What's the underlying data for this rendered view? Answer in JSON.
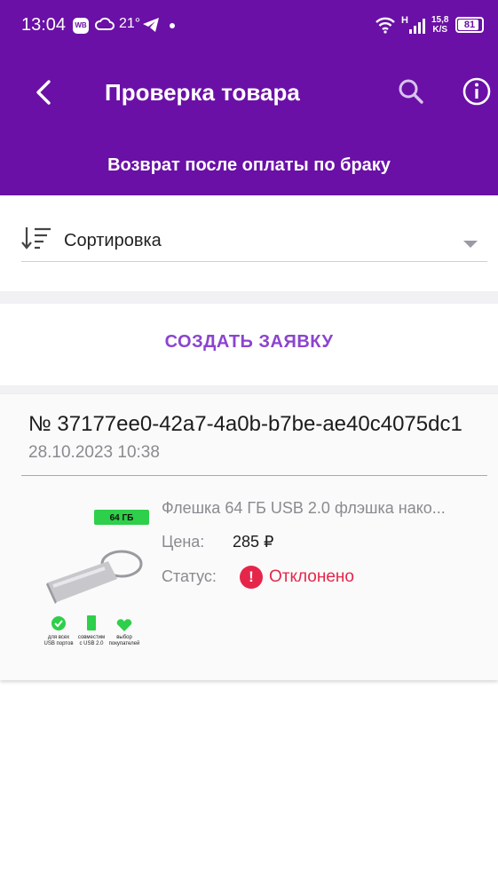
{
  "status_bar": {
    "time": "13:04",
    "wb_badge": "WB",
    "temperature": "21°",
    "network": "H",
    "speed_value": "15,8",
    "speed_unit": "K/S",
    "battery": "81",
    "battery_level": 0.81
  },
  "app_bar": {
    "title": "Проверка товара",
    "subtitle": "Возврат после оплаты по браку"
  },
  "sort": {
    "label": "Сортировка"
  },
  "actions": {
    "create_request": "СОЗДАТЬ ЗАЯВКУ"
  },
  "order": {
    "number": "№ 37177ee0-42a7-4a0b-b7be-ae40c4075dc1",
    "date": "28.10.2023 10:38",
    "product": {
      "name": "Флешка 64 ГБ USB 2.0 флэшка нако...",
      "price_label": "Цена:",
      "price": "285 ₽",
      "status_label": "Статус:",
      "status": "Отклонено",
      "image": {
        "badge": "64 ГБ",
        "feature1_line1": "для всех",
        "feature1_line2": "USB портов",
        "feature2_line1": "совместим",
        "feature2_line2": "с USB 2.0",
        "feature3_line1": "выбор",
        "feature3_line2": "покупателей"
      }
    }
  },
  "colors": {
    "primary": "#6a10a6",
    "accent": "#8c44cf",
    "error": "#e5264a"
  }
}
